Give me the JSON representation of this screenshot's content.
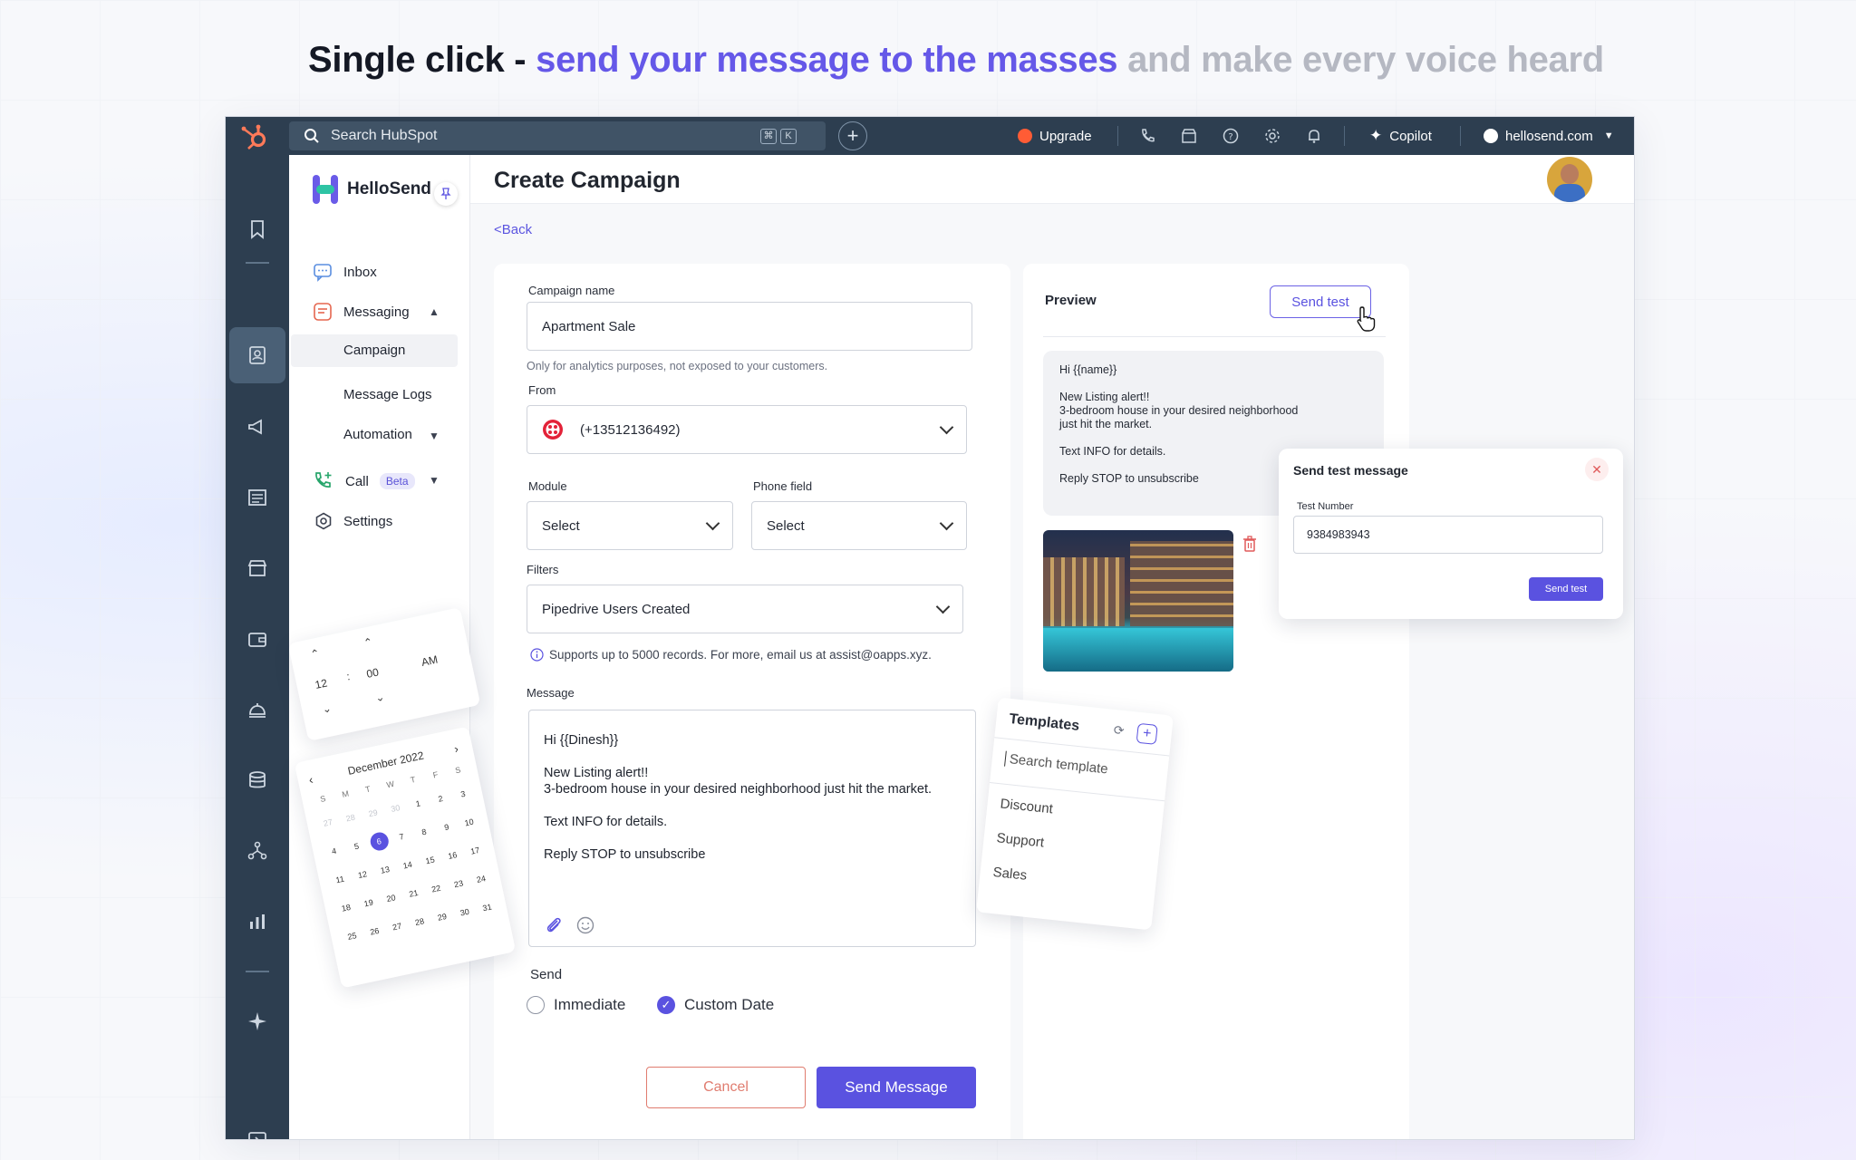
{
  "headline": {
    "part1": "Single click - ",
    "part2": "send your message to the masses",
    "part3": " and make every voice heard"
  },
  "topbar": {
    "search_placeholder": "Search HubSpot",
    "kbd_cmd": "⌘",
    "kbd_k": "K",
    "upgrade": "Upgrade",
    "copilot": "Copilot",
    "account": "hellosend.com"
  },
  "sidebar": {
    "brand": "HelloSend",
    "items": {
      "inbox": "Inbox",
      "messaging": "Messaging",
      "campaign": "Campaign",
      "message_logs": "Message Logs",
      "automation": "Automation",
      "call": "Call",
      "call_badge": "Beta",
      "settings": "Settings"
    }
  },
  "page": {
    "title": "Create Campaign",
    "back": "<Back"
  },
  "form": {
    "campaign_name_label": "Campaign name",
    "campaign_name_value": "Apartment Sale",
    "campaign_name_hint": "Only for analytics purposes, not exposed to your customers.",
    "from_label": "From",
    "from_value": "(+13512136492)",
    "module_label": "Module",
    "module_value": "Select",
    "phone_field_label": "Phone field",
    "phone_field_value": "Select",
    "filters_label": "Filters",
    "filters_value": "Pipedrive Users Created",
    "records_info": "Supports up to 5000 records. For more, email us at assist@oapps.xyz.",
    "message_label": "Message",
    "message_lines": [
      "Hi  {{Dinesh}}",
      "New Listing alert!!",
      "3-bedroom house in your desired neighborhood just hit the market.",
      "Text INFO for details.",
      "Reply STOP to unsubscribe"
    ],
    "send_label": "Send",
    "send_options": [
      "Immediate",
      "Custom Date"
    ],
    "send_selected": "Custom Date",
    "cancel": "Cancel",
    "send_message": "Send Message"
  },
  "preview": {
    "title": "Preview",
    "send_test": "Send test",
    "lines": [
      "Hi  {{name}}",
      "New Listing alert!!",
      "3-bedroom house in your desired neighborhood",
      "just hit the market.",
      "Text INFO for details.",
      "Reply STOP to unsubscribe"
    ]
  },
  "send_test_popup": {
    "title": "Send test message",
    "number_label": "Test Number",
    "number_value": "9384983943",
    "button": "Send test"
  },
  "templates": {
    "title": "Templates",
    "search_placeholder": "Search template",
    "items": [
      "Discount",
      "Support",
      "Sales"
    ]
  },
  "time_picker": {
    "hour": "12",
    "separator": ":",
    "minute": "00",
    "period": "AM"
  },
  "calendar": {
    "month": "December 2022",
    "weekdays": [
      "S",
      "M",
      "T",
      "W",
      "T",
      "F",
      "S"
    ],
    "rows": [
      [
        "27",
        "28",
        "29",
        "30",
        "1",
        "2",
        "3"
      ],
      [
        "4",
        "5",
        "6",
        "7",
        "8",
        "9",
        "10"
      ],
      [
        "11",
        "12",
        "13",
        "14",
        "15",
        "16",
        "17"
      ],
      [
        "18",
        "19",
        "20",
        "21",
        "22",
        "23",
        "24"
      ],
      [
        "25",
        "26",
        "27",
        "28",
        "29",
        "30",
        "31"
      ]
    ],
    "selected": "6"
  },
  "colors": {
    "accent": "#5a52e0",
    "nav_dark": "#2d3e50",
    "danger": "#e07c6f",
    "headline_purple": "#6558e8",
    "headline_grey": "#b5b8c2"
  }
}
